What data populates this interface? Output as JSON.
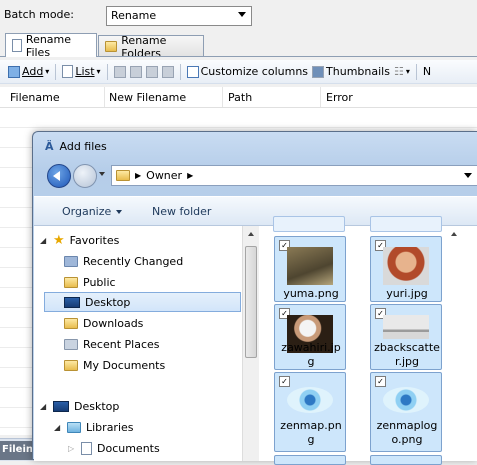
{
  "batch": {
    "label": "Batch mode:",
    "value": "Rename"
  },
  "tabs": [
    {
      "label": "Rename Files"
    },
    {
      "label": "Rename Folders"
    }
  ],
  "toolbar": {
    "add": "Add",
    "list": "List",
    "customize": "Customize columns",
    "thumbnails": "Thumbnails",
    "overflow": "N"
  },
  "grid": {
    "headers": [
      "Filename",
      "New Filename",
      "Path",
      "Error"
    ]
  },
  "statusbar": {
    "fileinfo": "Filein"
  },
  "dialog": {
    "title": "Add files",
    "address": {
      "crumb": "Owner"
    },
    "commands": {
      "organize": "Organize",
      "new_folder": "New folder"
    },
    "nav": {
      "favorites": "Favorites",
      "recently_changed": "Recently Changed",
      "public": "Public",
      "desktop_fav": "Desktop",
      "downloads": "Downloads",
      "recent_places": "Recent Places",
      "my_documents": "My Documents",
      "desktop": "Desktop",
      "libraries": "Libraries",
      "documents": "Documents"
    },
    "files": [
      {
        "name1": "yuma.png",
        "name2": ""
      },
      {
        "name1": "yuri.jpg",
        "name2": ""
      },
      {
        "name1": "zawahiri.jp",
        "name2": "g"
      },
      {
        "name1": "zbackscatte",
        "name2": "r.jpg"
      },
      {
        "name1": "zenmap.pn",
        "name2": "g"
      },
      {
        "name1": "zenmaplog",
        "name2": "o.png"
      }
    ]
  },
  "colors": {
    "accent": "#1d56b8",
    "tile_bg": "#cde6fb",
    "tile_border": "#7da2ce"
  }
}
